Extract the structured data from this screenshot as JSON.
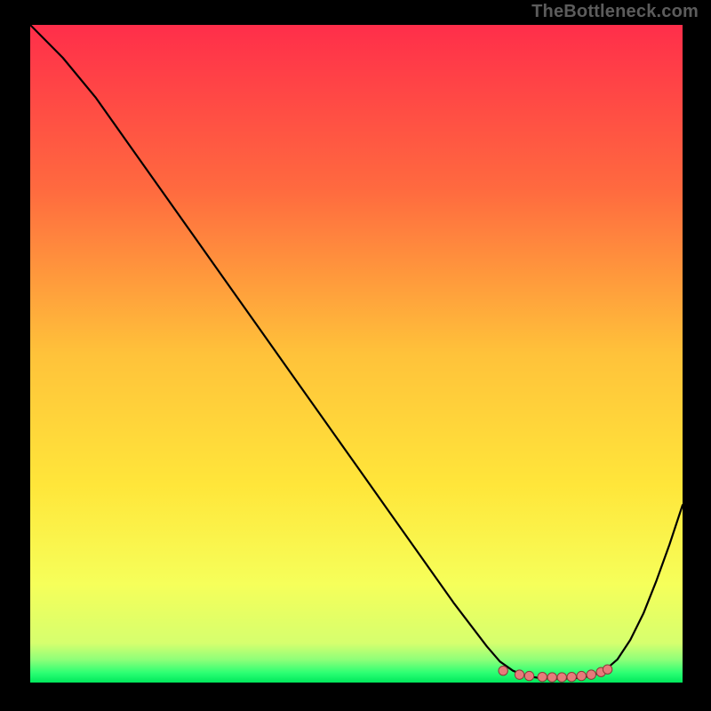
{
  "watermark": "TheBottleneck.com",
  "chart_data": {
    "type": "line",
    "title": "",
    "xlabel": "",
    "ylabel": "",
    "xlim": [
      0,
      100
    ],
    "ylim": [
      0,
      100
    ],
    "grid": false,
    "legend": false,
    "series": [
      {
        "name": "curve",
        "x": [
          0,
          5,
          10,
          15,
          20,
          25,
          30,
          35,
          40,
          45,
          50,
          55,
          60,
          65,
          70,
          72,
          74,
          76,
          78,
          80,
          82,
          84,
          86,
          88,
          90,
          92,
          94,
          96,
          98,
          100
        ],
        "y": [
          100,
          95,
          89,
          82,
          75,
          68,
          61,
          54,
          47,
          40,
          33,
          26,
          19,
          12,
          5.5,
          3.2,
          1.8,
          1.0,
          0.7,
          0.6,
          0.6,
          0.7,
          1.0,
          1.8,
          3.5,
          6.5,
          10.5,
          15.5,
          21.0,
          27.0
        ]
      },
      {
        "name": "markers",
        "x": [
          72.5,
          75.0,
          76.5,
          78.5,
          80.0,
          81.5,
          83.0,
          84.5,
          86.0,
          87.5,
          88.5
        ],
        "y": [
          1.8,
          1.2,
          1.0,
          0.85,
          0.8,
          0.8,
          0.85,
          1.0,
          1.2,
          1.6,
          2.0
        ]
      }
    ],
    "gradient_stops": [
      {
        "offset": 0.0,
        "color": "#ff2e4a"
      },
      {
        "offset": 0.25,
        "color": "#ff6a3f"
      },
      {
        "offset": 0.5,
        "color": "#ffc23a"
      },
      {
        "offset": 0.7,
        "color": "#ffe63a"
      },
      {
        "offset": 0.85,
        "color": "#f6ff5a"
      },
      {
        "offset": 0.94,
        "color": "#d6ff6e"
      },
      {
        "offset": 0.965,
        "color": "#8fff79"
      },
      {
        "offset": 0.985,
        "color": "#2dff73"
      },
      {
        "offset": 1.0,
        "color": "#00e85c"
      }
    ],
    "colors": {
      "curve": "#000000",
      "marker": "#e77b7b",
      "marker_stroke": "#8a3a3a",
      "background_outside": "#000000"
    }
  }
}
